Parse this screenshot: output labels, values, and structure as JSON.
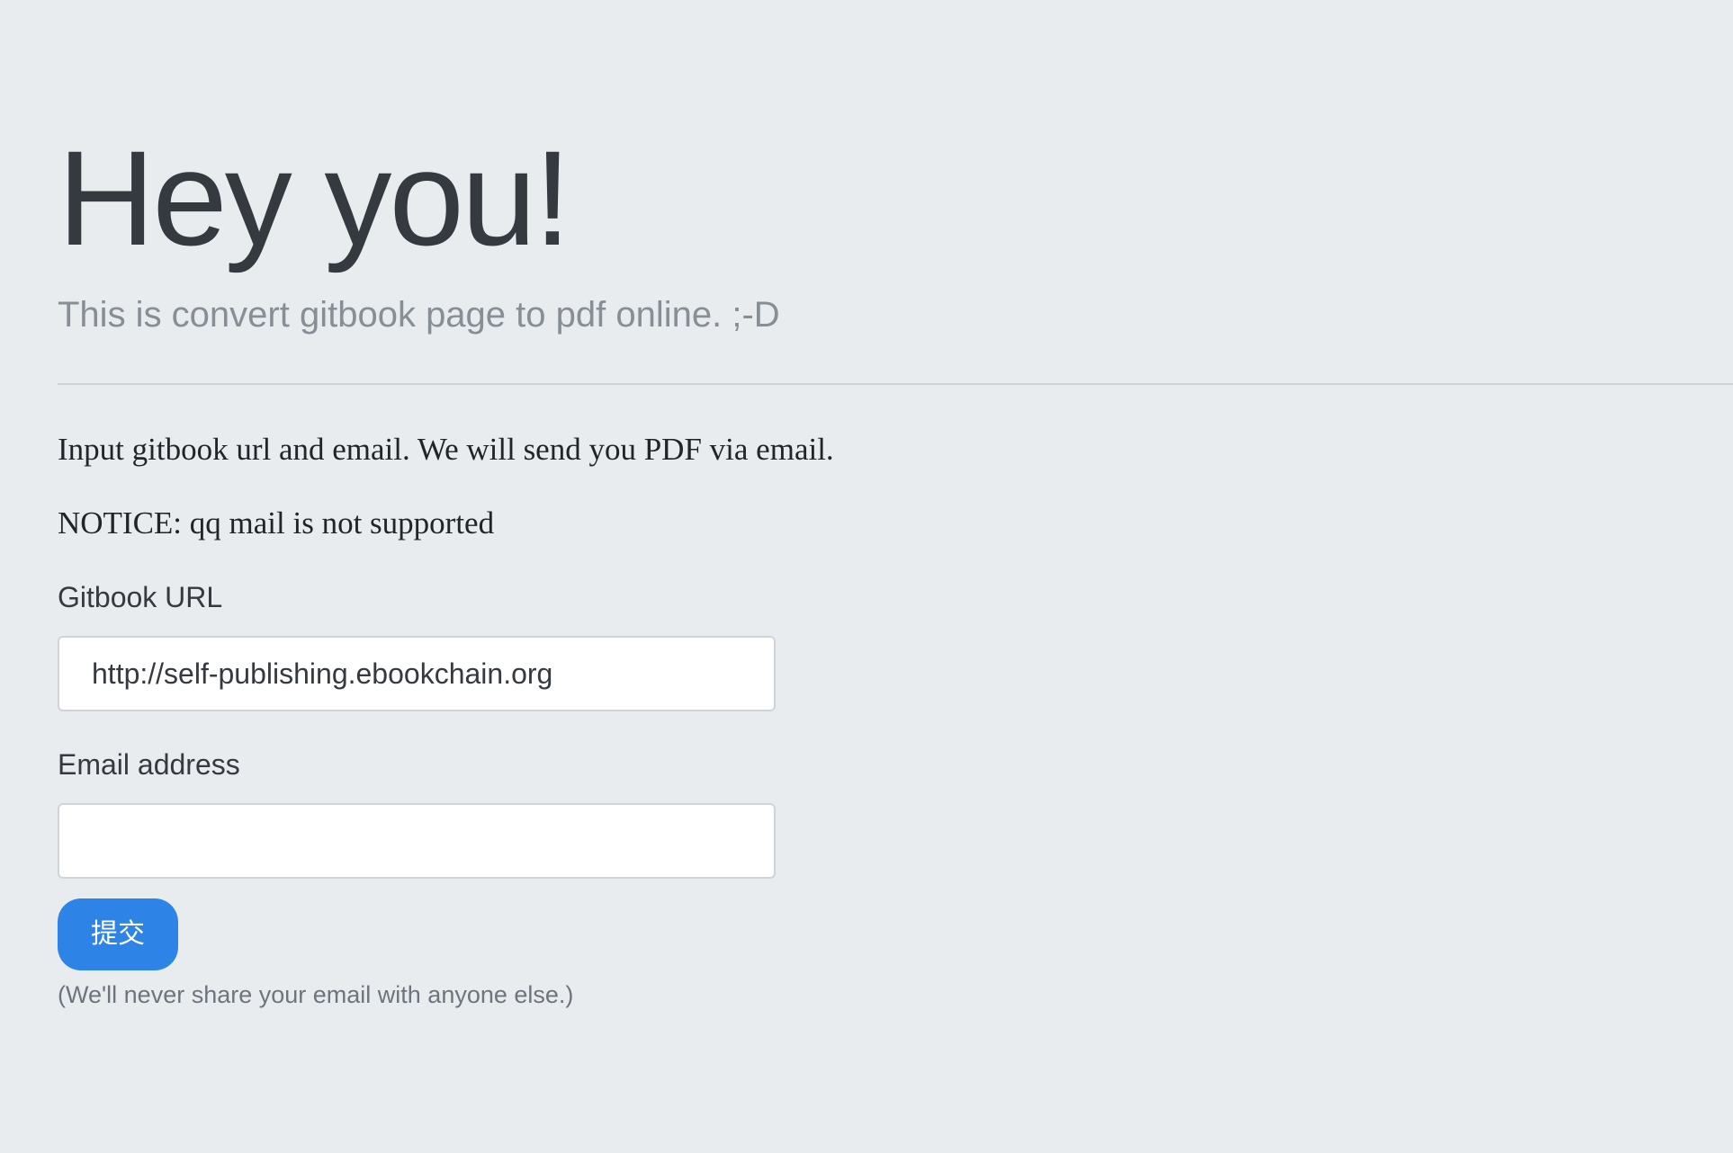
{
  "hero": {
    "title": "Hey you!",
    "subtitle": "This is convert gitbook page to pdf online. ;-D"
  },
  "info": {
    "instructions": "Input gitbook url and email. We will send you PDF via email.",
    "notice": "NOTICE: qq mail is not supported"
  },
  "form": {
    "url_label": "Gitbook URL",
    "url_value": "http://self-publishing.ebookchain.org",
    "email_label": "Email address",
    "email_value": "",
    "submit_label": "提交",
    "help_text": "(We'll never share your email with anyone else.)"
  },
  "colors": {
    "background": "#e9ecef",
    "primary_button": "#2e83e6"
  }
}
